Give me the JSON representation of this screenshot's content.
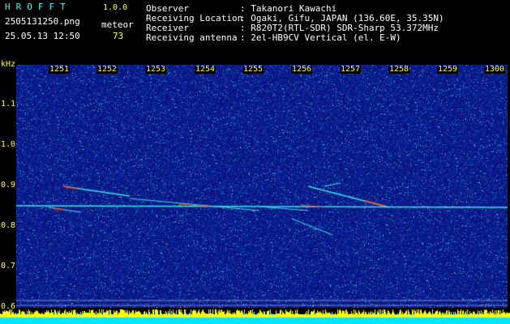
{
  "header": {
    "brand": "HROFFT",
    "version": "1.0.0",
    "filename": "2505131250.png",
    "datetime": "25.05.13 12:50",
    "meteor_label": "meteor",
    "meteor_count": "73",
    "fields": [
      {
        "label": "Observer",
        "value": ": Takanori Kawachi"
      },
      {
        "label": "Receiving Location",
        "value": ": Ogaki, Gifu, JAPAN (136.60E, 35.35N)"
      },
      {
        "label": "Receiver",
        "value": ": R820T2(RTL-SDR) SDR-Sharp 53.372MHz"
      },
      {
        "label": "Receiving antenna",
        "value": ": 2el-HB9CV Vertical (el. E-W)"
      }
    ]
  },
  "axes": {
    "y_unit": "kHz",
    "y_ticks": [
      "1.1",
      "1.0",
      "0.9",
      "0.8",
      "0.7",
      "0.6"
    ],
    "x_ticks": [
      "1251",
      "1252",
      "1253",
      "1254",
      "1255",
      "1256",
      "1257",
      "1258",
      "1259",
      "1300"
    ]
  },
  "colors": {
    "background": "#0a1a8c",
    "text_white": "#ffffff",
    "text_cyan": "#4cf2f2",
    "text_yellow": "#ffff3c",
    "trace_cyan": "#33e6e6",
    "trace_hot": "#ff4a1a"
  }
}
